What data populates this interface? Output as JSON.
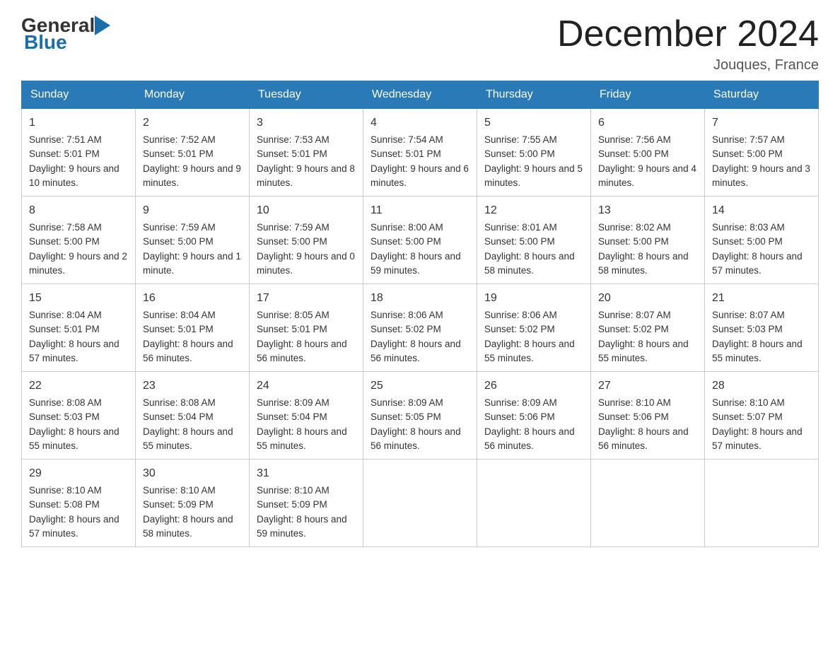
{
  "logo": {
    "general": "General",
    "blue": "Blue",
    "arrow_color": "#1a6fa8"
  },
  "header": {
    "title": "December 2024",
    "location": "Jouques, France"
  },
  "days_of_week": [
    "Sunday",
    "Monday",
    "Tuesday",
    "Wednesday",
    "Thursday",
    "Friday",
    "Saturday"
  ],
  "weeks": [
    [
      {
        "day": "1",
        "sunrise": "7:51 AM",
        "sunset": "5:01 PM",
        "daylight": "9 hours and 10 minutes."
      },
      {
        "day": "2",
        "sunrise": "7:52 AM",
        "sunset": "5:01 PM",
        "daylight": "9 hours and 9 minutes."
      },
      {
        "day": "3",
        "sunrise": "7:53 AM",
        "sunset": "5:01 PM",
        "daylight": "9 hours and 8 minutes."
      },
      {
        "day": "4",
        "sunrise": "7:54 AM",
        "sunset": "5:01 PM",
        "daylight": "9 hours and 6 minutes."
      },
      {
        "day": "5",
        "sunrise": "7:55 AM",
        "sunset": "5:00 PM",
        "daylight": "9 hours and 5 minutes."
      },
      {
        "day": "6",
        "sunrise": "7:56 AM",
        "sunset": "5:00 PM",
        "daylight": "9 hours and 4 minutes."
      },
      {
        "day": "7",
        "sunrise": "7:57 AM",
        "sunset": "5:00 PM",
        "daylight": "9 hours and 3 minutes."
      }
    ],
    [
      {
        "day": "8",
        "sunrise": "7:58 AM",
        "sunset": "5:00 PM",
        "daylight": "9 hours and 2 minutes."
      },
      {
        "day": "9",
        "sunrise": "7:59 AM",
        "sunset": "5:00 PM",
        "daylight": "9 hours and 1 minute."
      },
      {
        "day": "10",
        "sunrise": "7:59 AM",
        "sunset": "5:00 PM",
        "daylight": "9 hours and 0 minutes."
      },
      {
        "day": "11",
        "sunrise": "8:00 AM",
        "sunset": "5:00 PM",
        "daylight": "8 hours and 59 minutes."
      },
      {
        "day": "12",
        "sunrise": "8:01 AM",
        "sunset": "5:00 PM",
        "daylight": "8 hours and 58 minutes."
      },
      {
        "day": "13",
        "sunrise": "8:02 AM",
        "sunset": "5:00 PM",
        "daylight": "8 hours and 58 minutes."
      },
      {
        "day": "14",
        "sunrise": "8:03 AM",
        "sunset": "5:00 PM",
        "daylight": "8 hours and 57 minutes."
      }
    ],
    [
      {
        "day": "15",
        "sunrise": "8:04 AM",
        "sunset": "5:01 PM",
        "daylight": "8 hours and 57 minutes."
      },
      {
        "day": "16",
        "sunrise": "8:04 AM",
        "sunset": "5:01 PM",
        "daylight": "8 hours and 56 minutes."
      },
      {
        "day": "17",
        "sunrise": "8:05 AM",
        "sunset": "5:01 PM",
        "daylight": "8 hours and 56 minutes."
      },
      {
        "day": "18",
        "sunrise": "8:06 AM",
        "sunset": "5:02 PM",
        "daylight": "8 hours and 56 minutes."
      },
      {
        "day": "19",
        "sunrise": "8:06 AM",
        "sunset": "5:02 PM",
        "daylight": "8 hours and 55 minutes."
      },
      {
        "day": "20",
        "sunrise": "8:07 AM",
        "sunset": "5:02 PM",
        "daylight": "8 hours and 55 minutes."
      },
      {
        "day": "21",
        "sunrise": "8:07 AM",
        "sunset": "5:03 PM",
        "daylight": "8 hours and 55 minutes."
      }
    ],
    [
      {
        "day": "22",
        "sunrise": "8:08 AM",
        "sunset": "5:03 PM",
        "daylight": "8 hours and 55 minutes."
      },
      {
        "day": "23",
        "sunrise": "8:08 AM",
        "sunset": "5:04 PM",
        "daylight": "8 hours and 55 minutes."
      },
      {
        "day": "24",
        "sunrise": "8:09 AM",
        "sunset": "5:04 PM",
        "daylight": "8 hours and 55 minutes."
      },
      {
        "day": "25",
        "sunrise": "8:09 AM",
        "sunset": "5:05 PM",
        "daylight": "8 hours and 56 minutes."
      },
      {
        "day": "26",
        "sunrise": "8:09 AM",
        "sunset": "5:06 PM",
        "daylight": "8 hours and 56 minutes."
      },
      {
        "day": "27",
        "sunrise": "8:10 AM",
        "sunset": "5:06 PM",
        "daylight": "8 hours and 56 minutes."
      },
      {
        "day": "28",
        "sunrise": "8:10 AM",
        "sunset": "5:07 PM",
        "daylight": "8 hours and 57 minutes."
      }
    ],
    [
      {
        "day": "29",
        "sunrise": "8:10 AM",
        "sunset": "5:08 PM",
        "daylight": "8 hours and 57 minutes."
      },
      {
        "day": "30",
        "sunrise": "8:10 AM",
        "sunset": "5:09 PM",
        "daylight": "8 hours and 58 minutes."
      },
      {
        "day": "31",
        "sunrise": "8:10 AM",
        "sunset": "5:09 PM",
        "daylight": "8 hours and 59 minutes."
      },
      null,
      null,
      null,
      null
    ]
  ],
  "labels": {
    "sunrise": "Sunrise:",
    "sunset": "Sunset:",
    "daylight": "Daylight:"
  }
}
